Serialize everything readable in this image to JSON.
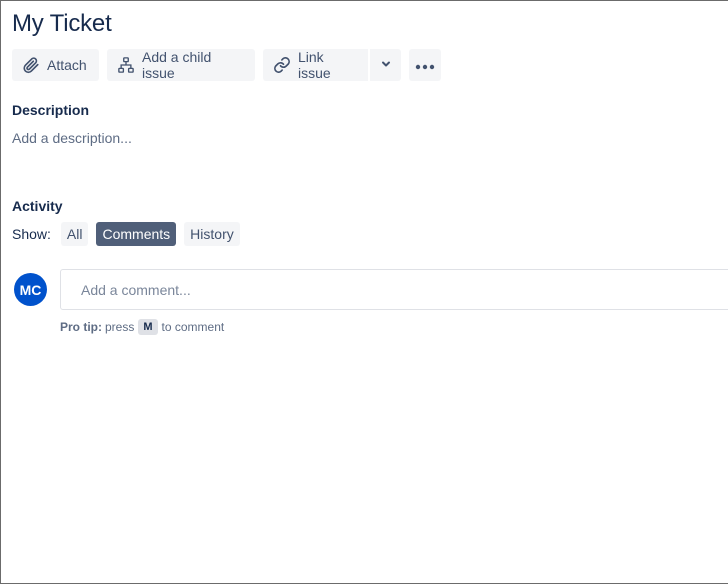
{
  "ticket": {
    "title": "My Ticket"
  },
  "toolbar": {
    "attach_label": "Attach",
    "add_child_label": "Add a child issue",
    "link_issue_label": "Link issue",
    "icons": {
      "attach": "paperclip-icon",
      "add_child": "hierarchy-icon",
      "link": "link-icon",
      "dropdown": "chevron-down-icon",
      "more": "more-horizontal-icon"
    }
  },
  "description": {
    "heading": "Description",
    "placeholder": "Add a description..."
  },
  "activity": {
    "heading": "Activity",
    "show_label": "Show:",
    "filters": [
      {
        "label": "All",
        "active": false
      },
      {
        "label": "Comments",
        "active": true
      },
      {
        "label": "History",
        "active": false
      }
    ]
  },
  "comment": {
    "avatar_initials": "MC",
    "placeholder": "Add a comment...",
    "protip_bold": "Pro tip:",
    "protip_press": "press",
    "protip_key": "M",
    "protip_suffix": "to comment"
  },
  "colors": {
    "accent": "#0052cc",
    "active_filter": "#505f79",
    "button_bg": "#f4f5f7",
    "text_primary": "#172b4d",
    "text_secondary": "#42526e"
  }
}
